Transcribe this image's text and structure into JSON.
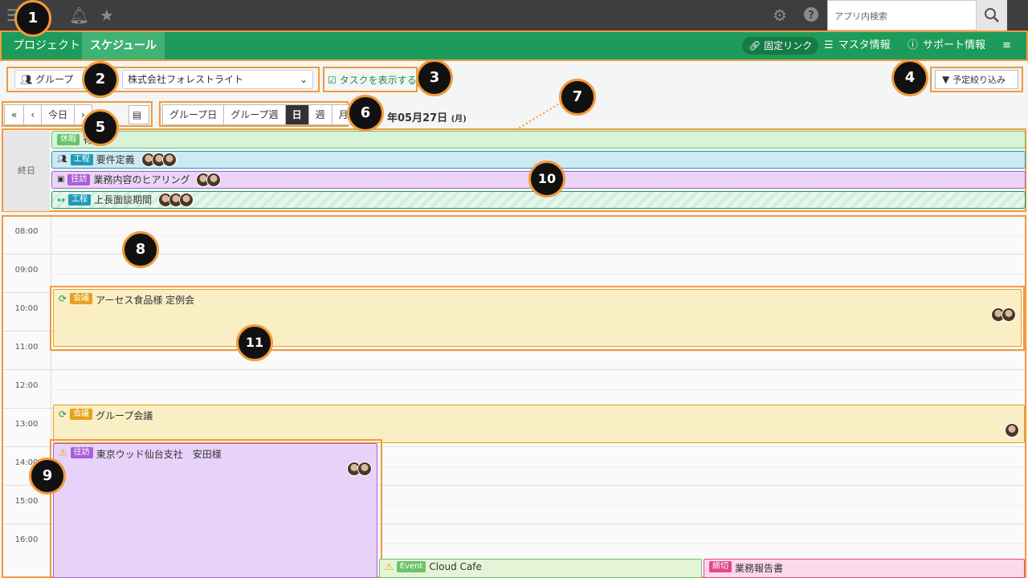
{
  "topbar": {
    "search_placeholder": "アプリ内検索"
  },
  "nav": {
    "tabs": [
      {
        "label": "プロジェクト"
      },
      {
        "label": "スケジュール"
      }
    ],
    "permalink": "固定リンク",
    "master": "マスタ情報",
    "support": "サポート情報"
  },
  "toolbar": {
    "group_label": "グループ",
    "company": "株式会社フォレストライト",
    "show_tasks": "タスクを表示する",
    "filter": "予定絞り込み"
  },
  "datenav": {
    "today": "今日",
    "views": [
      "グループ日",
      "グループ週",
      "日",
      "週",
      "月"
    ],
    "date_text": "年05月27日",
    "weekday": "(月)"
  },
  "allday": {
    "label": "終日",
    "events": [
      {
        "tag": "休暇",
        "title": "有",
        "color": "#6cc36a"
      },
      {
        "tag": "工程",
        "title": "要件定義",
        "color": "#1e9bb8"
      },
      {
        "tag": "往訪",
        "title": "業務内容のヒアリング",
        "color": "#a95fd8"
      },
      {
        "tag": "工程",
        "title": "上長面談期間",
        "color": "#1e9bb8"
      }
    ]
  },
  "hours": [
    "08:00",
    "09:00",
    "10:00",
    "11:00",
    "12:00",
    "13:00",
    "14:00",
    "15:00",
    "16:00"
  ],
  "events": [
    {
      "tag": "会議",
      "title": "アーセス食品様 定例会",
      "color": "#e6a21a"
    },
    {
      "tag": "会議",
      "title": "グループ会議",
      "color": "#e6a21a"
    },
    {
      "tag": "往訪",
      "title": "東京ウッド仙台支社　安田様",
      "color": "#a95fd8"
    },
    {
      "tag": "Event",
      "title": "Cloud Cafe",
      "color": "#6cc36a"
    },
    {
      "tag": "締切",
      "title": "業務報告書",
      "color": "#e0488f"
    }
  ],
  "callouts": [
    "1",
    "2",
    "3",
    "4",
    "5",
    "6",
    "7",
    "8",
    "9",
    "10",
    "11"
  ]
}
